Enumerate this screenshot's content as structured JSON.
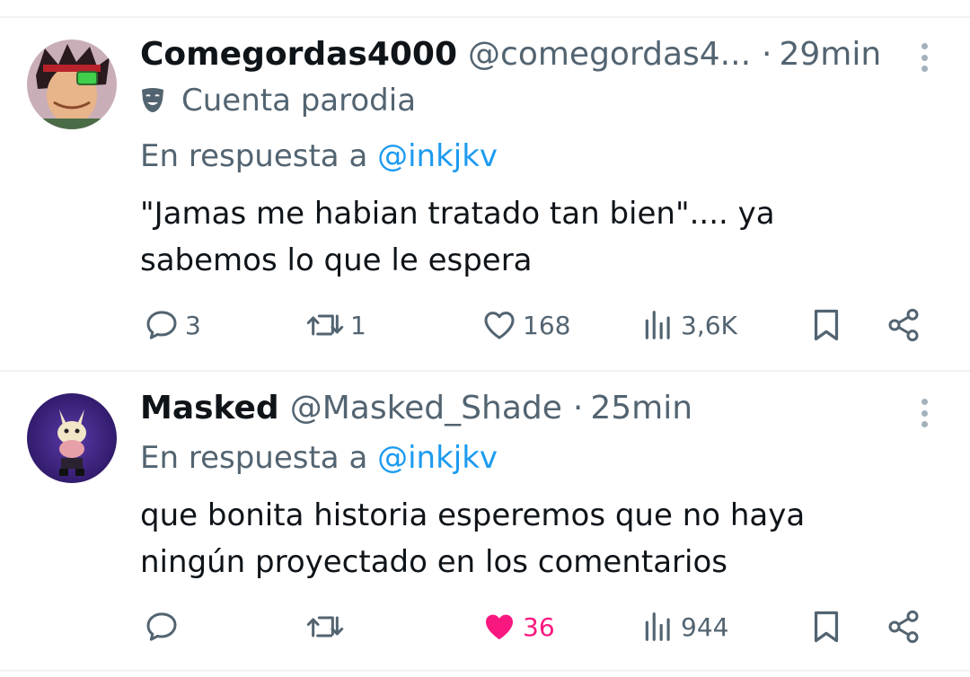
{
  "tweets": [
    {
      "name": "Comegordas4000",
      "handle": "@comegordas4...",
      "dot": "·",
      "time": "29min",
      "badge_icon": "theater-mask-icon",
      "badge_label": "Cuenta parodia",
      "reply_prefix": "En respuesta a",
      "reply_mention": "@inkjkv",
      "text_line1": "\"Jamas me habian tratado tan bien\".... ya",
      "text_line2": "sabemos lo que le espera",
      "replies": "3",
      "retweets": "1",
      "likes": "168",
      "views": "3,6K",
      "liked": false
    },
    {
      "name": "Masked",
      "handle": "@Masked_Shade",
      "dot": "·",
      "time": "25min",
      "reply_prefix": "En respuesta a",
      "reply_mention": "@inkjkv",
      "text_line1": "que bonita historia esperemos que no haya",
      "text_line2": "ningún proyectado en los comentarios",
      "replies": "",
      "retweets": "",
      "likes": "36",
      "views": "944",
      "liked": true
    }
  ],
  "colors": {
    "text_primary": "#0f1419",
    "text_secondary": "#536471",
    "link": "#1d9bf0",
    "like_active": "#f91880",
    "divider": "#eff3f4"
  },
  "icons": [
    "reply-icon",
    "retweet-icon",
    "like-icon",
    "views-icon",
    "bookmark-icon",
    "share-icon",
    "more-icon"
  ]
}
